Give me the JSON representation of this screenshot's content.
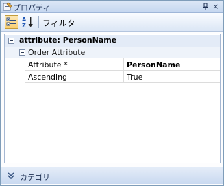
{
  "window": {
    "title": "プロパティ",
    "pin_glyph": "ᵖ",
    "close_glyph": "×"
  },
  "toolbar": {
    "filter_label": "フィルタ",
    "sort_icon_text": "A Z"
  },
  "grid": {
    "group": {
      "label": "attribute: PersonName"
    },
    "subgroup": {
      "label": "Order Attribute"
    },
    "properties": [
      {
        "name": "Attribute *",
        "value": "PersonName",
        "value_bold": true
      },
      {
        "name": "Ascending",
        "value": "True",
        "value_bold": false
      }
    ]
  },
  "footer": {
    "label": "カテゴリ"
  }
}
